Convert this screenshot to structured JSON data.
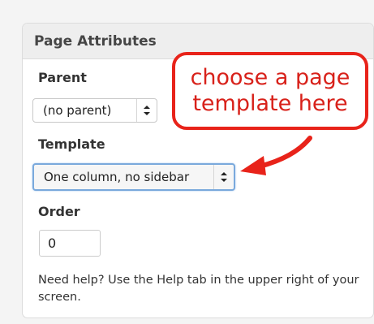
{
  "panel": {
    "title": "Page Attributes",
    "parent": {
      "label": "Parent",
      "selected": "(no parent)"
    },
    "template": {
      "label": "Template",
      "selected": "One column, no sidebar"
    },
    "order": {
      "label": "Order",
      "value": "0"
    },
    "help_text": "Need help? Use the Help tab in the upper right of your screen."
  },
  "annotation": {
    "text": "choose a page template here",
    "color": "#e8231a"
  }
}
